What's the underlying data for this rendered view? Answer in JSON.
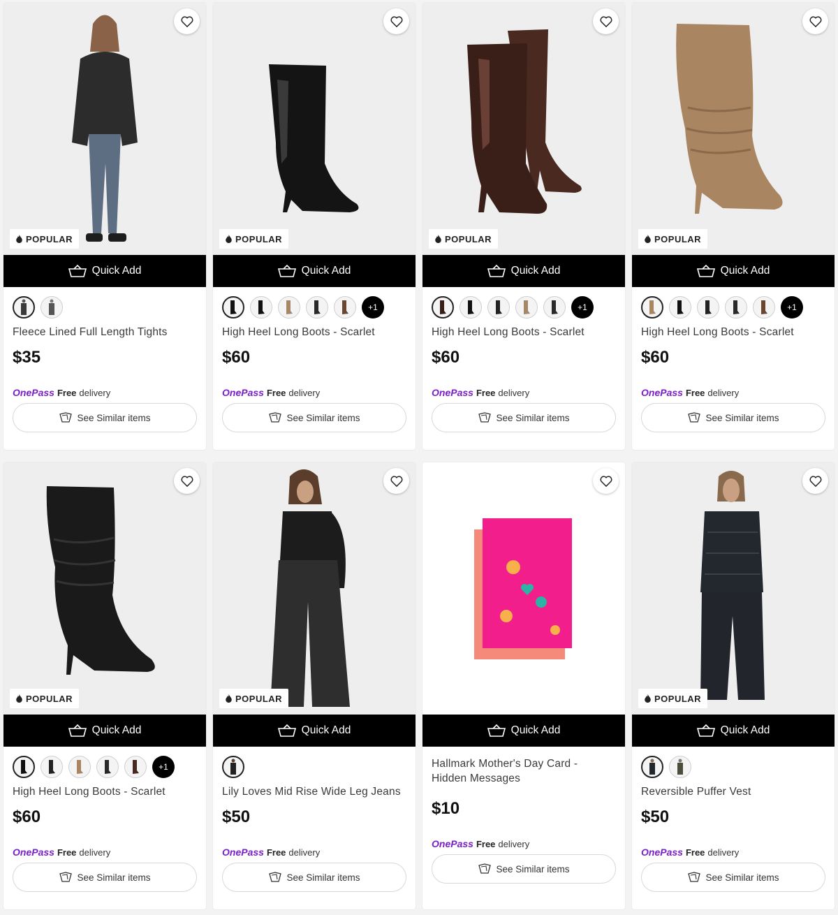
{
  "popular_label": "POPULAR",
  "quick_add_label": "Quick Add",
  "onepass": {
    "logo": "OnePass",
    "free": "Free",
    "delivery": "delivery"
  },
  "similar_label": "See Similar items",
  "colors": {
    "brand_purple": "#7a1fc9",
    "black": "#000000"
  },
  "products": [
    {
      "name": "Fleece Lined Full Length Tights",
      "price": "$35",
      "popular": true,
      "swatches": 2,
      "more": "",
      "image": "woman-tights"
    },
    {
      "name": "High Heel Long Boots - Scarlet",
      "price": "$60",
      "popular": true,
      "swatches": 5,
      "more": "+1",
      "image": "black-boot"
    },
    {
      "name": "High Heel Long Boots - Scarlet",
      "price": "$60",
      "popular": true,
      "swatches": 5,
      "more": "+1",
      "image": "brown-boots"
    },
    {
      "name": "High Heel Long Boots - Scarlet",
      "price": "$60",
      "popular": true,
      "swatches": 5,
      "more": "+1",
      "image": "tan-boot"
    },
    {
      "name": "High Heel Long Boots - Scarlet",
      "price": "$60",
      "popular": true,
      "swatches": 5,
      "more": "+1",
      "image": "black-suede-boot"
    },
    {
      "name": "Lily Loves Mid Rise Wide Leg Jeans",
      "price": "$50",
      "popular": true,
      "swatches": 1,
      "more": "",
      "image": "woman-jeans"
    },
    {
      "name": "Hallmark Mother's Day Card - Hidden Messages",
      "price": "$10",
      "popular": false,
      "swatches": 0,
      "more": "",
      "image": "pink-card"
    },
    {
      "name": "Reversible Puffer Vest",
      "price": "$50",
      "popular": true,
      "swatches": 2,
      "more": "",
      "image": "woman-vest"
    }
  ]
}
